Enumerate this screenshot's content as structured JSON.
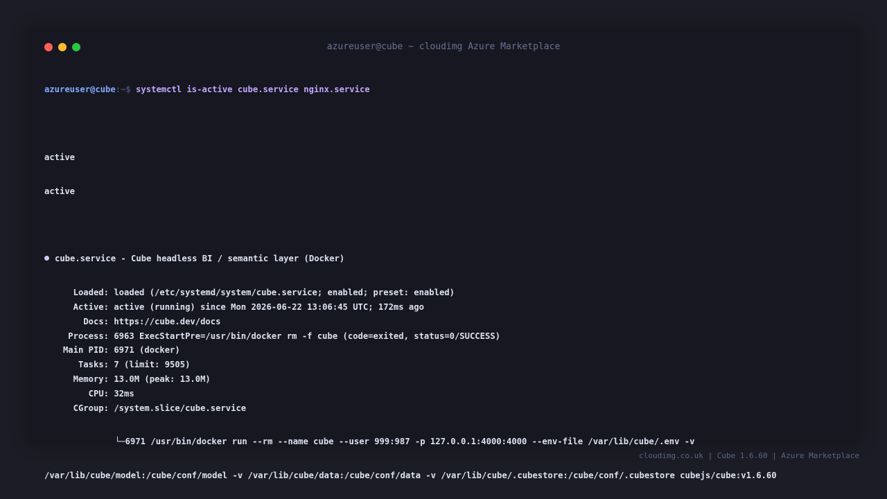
{
  "window": {
    "title": "azureuser@cube ~ cloudimg Azure Marketplace",
    "controls": [
      {
        "name": "close-button",
        "color": "#ff5f57"
      },
      {
        "name": "minimize-button",
        "color": "#febc2e"
      },
      {
        "name": "maximize-button",
        "color": "#28c840"
      }
    ]
  },
  "terminal": {
    "prompt": {
      "user_host": "azureuser@cube",
      "path": ":~$ ",
      "command": "systemctl is-active cube.service nginx.service"
    },
    "outputs": [
      "active",
      "active"
    ],
    "status": {
      "header": "cube.service - Cube headless BI / semantic layer (Docker)",
      "fields": [
        {
          "key": "Loaded:",
          "value": "loaded (/etc/systemd/system/cube.service; enabled; preset: enabled)"
        },
        {
          "key": "Active:",
          "value": "active (running) since Mon 2026-06-22 13:06:45 UTC; 172ms ago"
        },
        {
          "key": "Docs:",
          "value": "https://cube.dev/docs"
        },
        {
          "key": "Process:",
          "value": "6963 ExecStartPre=/usr/bin/docker rm -f cube (code=exited, status=0/SUCCESS)"
        },
        {
          "key": "Main PID:",
          "value": "6971 (docker)"
        },
        {
          "key": "Tasks:",
          "value": "7 (limit: 9505)"
        },
        {
          "key": "Memory:",
          "value": "13.0M (peak: 13.0M)"
        },
        {
          "key": "CPU:",
          "value": "32ms"
        },
        {
          "key": "CGroup:",
          "value": "/system.slice/cube.service"
        }
      ],
      "cgroup_child": "└─6971 /usr/bin/docker run --rm --name cube --user 999:987 -p 127.0.0.1:4000:4000 --env-file /var/lib/cube/.env -v",
      "wrap_line": "/var/lib/cube/model:/cube/conf/model -v /var/lib/cube/data:/cube/conf/data -v /var/lib/cube/.cubestore:/cube/conf/.cubestore cubejs/cube:v1.6.60"
    }
  },
  "footer": {
    "text": "cloudimg.co.uk | Cube 1.6.60 | Azure Marketplace"
  }
}
